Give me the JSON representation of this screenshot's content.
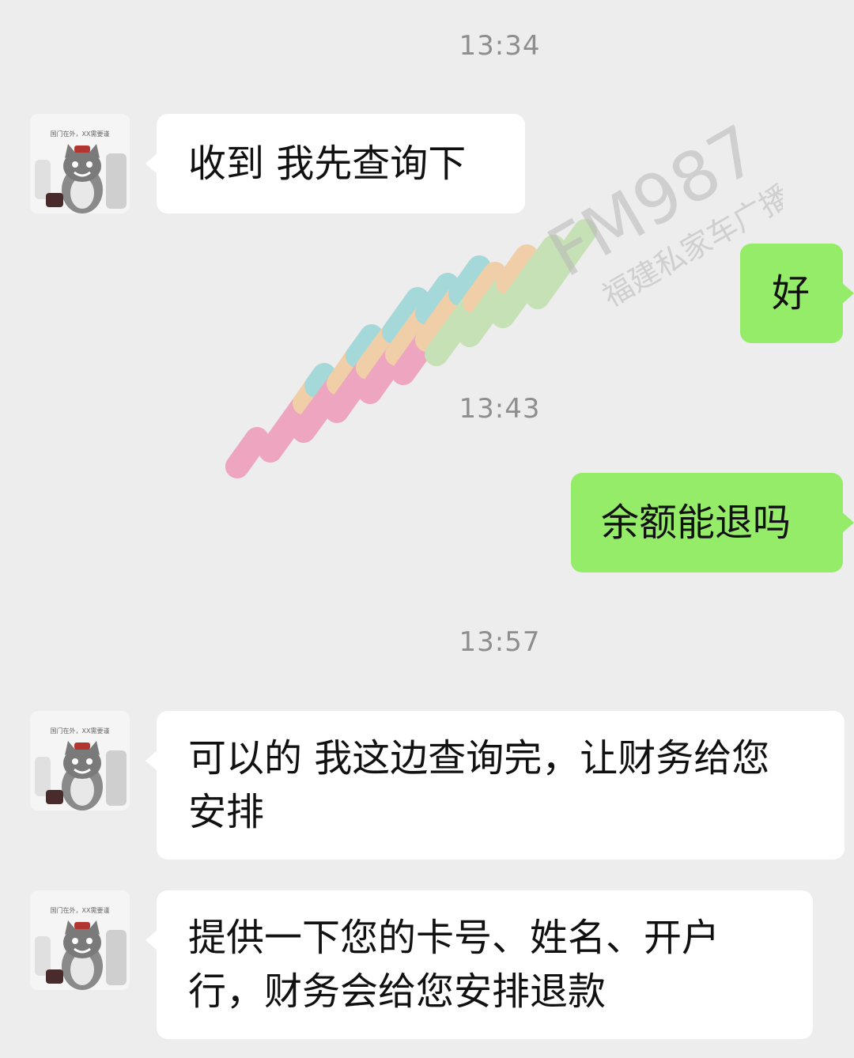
{
  "timestamps": [
    "13:34",
    "13:43",
    "13:57"
  ],
  "messages": [
    {
      "side": "left",
      "text": "收到 我先查询下"
    },
    {
      "side": "right",
      "text": "好"
    },
    {
      "side": "right",
      "text": "余额能退吗"
    },
    {
      "side": "left",
      "lines": [
        "可以的 我这边查询完，让财务给您",
        "安排"
      ]
    },
    {
      "side": "left",
      "lines": [
        "提供一下您的卡号、姓名、开户",
        "行，财务会给您安排退款"
      ]
    }
  ],
  "avatar": {
    "caption": "国门在外，XX需要谨",
    "icon": "cat-avatar-icon"
  },
  "watermark": {
    "brand": "FM987",
    "subtitle": "福建私家车广播"
  },
  "colors": {
    "background": "#ededed",
    "incoming": "#ffffff",
    "outgoing": "#95ec69"
  }
}
